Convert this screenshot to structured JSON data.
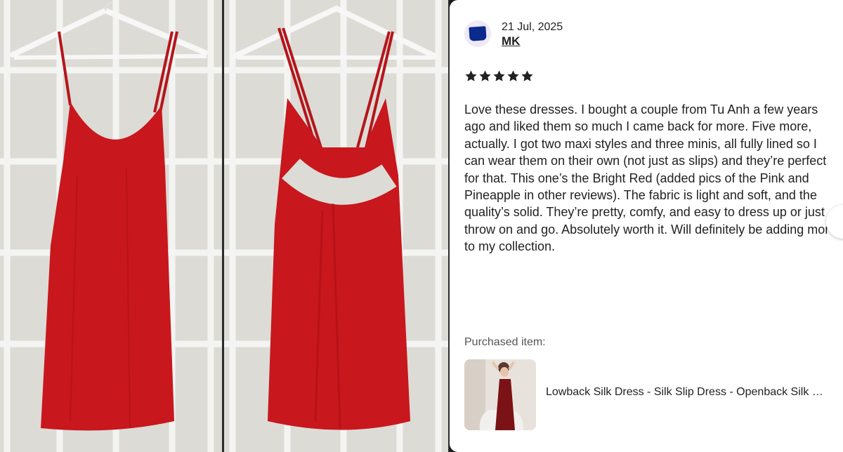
{
  "review": {
    "date": "21 Jul, 2025",
    "reviewer": "MK",
    "rating": 5,
    "text": "Love these dresses. I bought a couple from Tu Anh a few years ago and liked them so much I came back for more. Five more, actually. I got two maxi styles and three minis, all fully lined so I can wear them on their own (not just as slips) and they’re perfect for that. This one’s the Bright Red (added pics of the Pink and Pineapple in other reviews). The fabric is light and soft, and the quality’s solid. They’re pretty, comfy, and easy to dress up or just throw on and go. Absolutely worth it. Will definitely be adding more to my collection."
  },
  "purchase": {
    "label": "Purchased item:",
    "title": "Lowback Silk Dress - Silk Slip Dress - Openback Silk Dress"
  },
  "icons": {
    "avatar": "avatar-icon",
    "star": "star-icon"
  },
  "colors": {
    "star": "#222222",
    "dress_red": "#c8171d",
    "avatar_bg": "#eee8f7",
    "avatar_fg": "#0a2a8c"
  }
}
